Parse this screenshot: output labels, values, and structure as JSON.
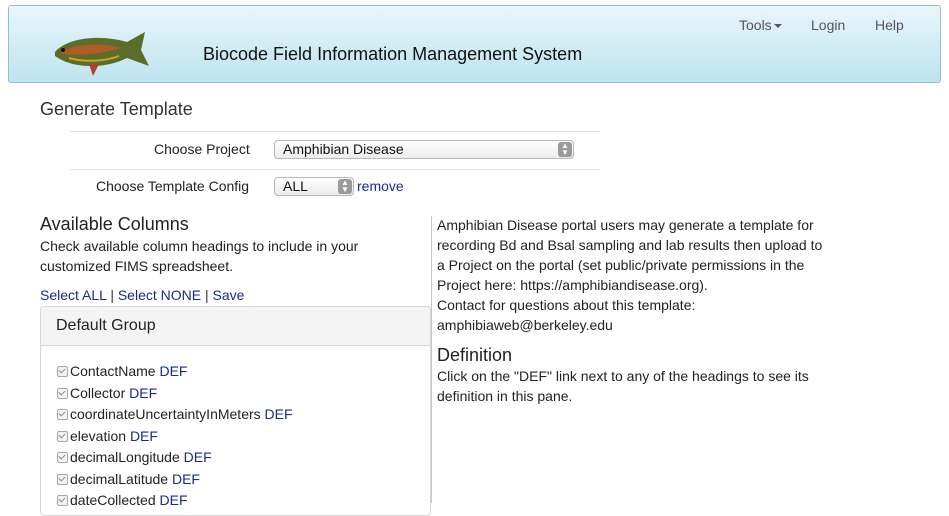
{
  "header": {
    "title": "Biocode Field Information Management System",
    "nav": {
      "tools": "Tools",
      "login": "Login",
      "help": "Help"
    }
  },
  "page_title": "Generate Template",
  "form": {
    "project_label": "Choose Project",
    "project_value": "Amphibian Disease",
    "config_label": "Choose Template Config",
    "config_value": "ALL",
    "remove_label": "remove"
  },
  "available": {
    "heading": "Available Columns",
    "desc_line1": "Check available column headings to include in your",
    "desc_line2": "customized FIMS spreadsheet.",
    "select_all": "Select ALL",
    "select_none": "Select NONE",
    "save": "Save",
    "separator": "|"
  },
  "group": {
    "title": "Default Group",
    "def_label": "DEF",
    "columns": [
      "ContactName",
      "Collector",
      "coordinateUncertaintyInMeters",
      "elevation",
      "decimalLongitude",
      "decimalLatitude",
      "dateCollected"
    ]
  },
  "info": {
    "lines": [
      "Amphibian Disease portal users may generate a template for",
      "recording Bd and Bsal sampling and lab results then upload to",
      "a Project on the portal (set public/private permissions in the",
      "Project here: https://amphibiandisease.org).",
      "Contact for questions about this template:",
      "amphibiaweb@berkeley.edu"
    ]
  },
  "definition": {
    "heading": "Definition",
    "line1": "Click on the \"DEF\" link next to any of the headings to see its",
    "line2": "definition in this pane."
  }
}
